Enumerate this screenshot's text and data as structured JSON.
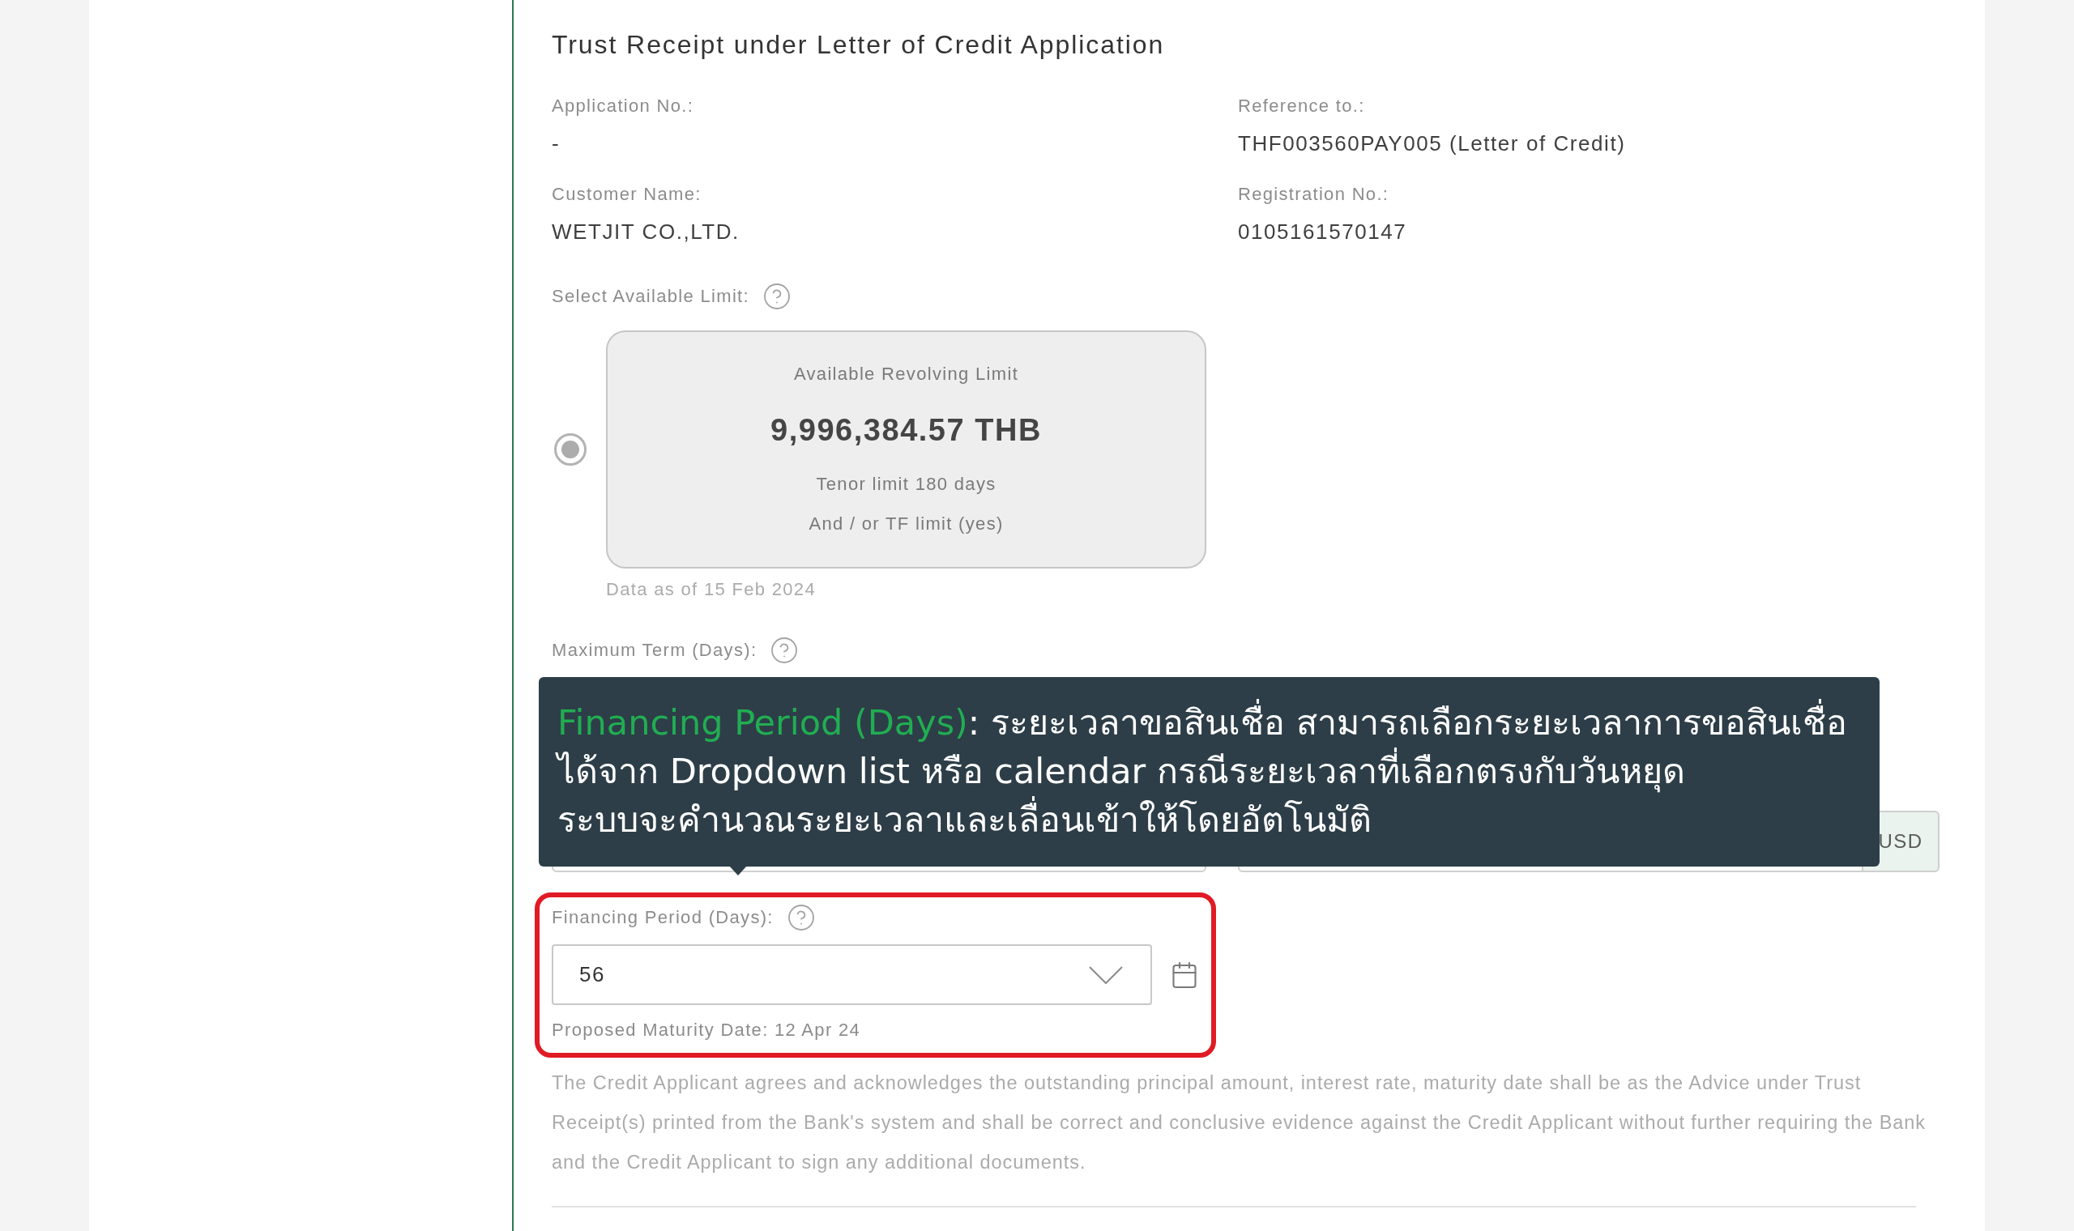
{
  "page_title": "Trust Receipt under Letter of Credit Application",
  "details": [
    {
      "label": "Application No.:",
      "value": "-"
    },
    {
      "label": "Reference to.:",
      "value": "THF003560PAY005 (Letter of Credit)"
    },
    {
      "label": "Customer Name:",
      "value": "WETJIT CO.,LTD."
    },
    {
      "label": "Registration No.:",
      "value": "0105161570147"
    }
  ],
  "available_limit": {
    "label": "Select Available Limit:",
    "options": [
      {
        "selected": true,
        "title": "Available Revolving Limit",
        "amount": "9,996,384.57 THB",
        "notes": [
          "Tenor limit 180 days",
          "And / or TF limit (yes)"
        ]
      }
    ],
    "data_as_of": "Data as of 15 Feb 2024"
  },
  "maximum_term": {
    "label": "Maximum Term (Days):"
  },
  "amount_fields": {
    "currency": "USD"
  },
  "tooltip": {
    "term": "Financing Period (Days)",
    "lines": [
      ": ระยะเวลาขอสินเชื่อ สามารถเลือกระยะเวลาการขอสินเชื่อ",
      "ได้จาก Dropdown list หรือ calendar กรณีระยะเวลาที่เลือกตรงกับวันหยุด",
      "ระบบจะคำนวณระยะเวลาและเลื่อนเข้าให้โดยอัตโนมัติ"
    ]
  },
  "financing_period": {
    "highlighted": true,
    "label": "Financing Period (Days):",
    "value": "56",
    "proposed_maturity": "Proposed Maturity Date: 12 Apr 24"
  },
  "disclaimer": "The Credit Applicant agrees and acknowledges the outstanding principal amount, interest rate, maturity date shall be as the Advice under Trust Receipt(s) printed from the Bank's system and shall be correct and conclusive evidence against the Credit Applicant without further requiring the Bank and the Credit Applicant to sign any additional documents."
}
